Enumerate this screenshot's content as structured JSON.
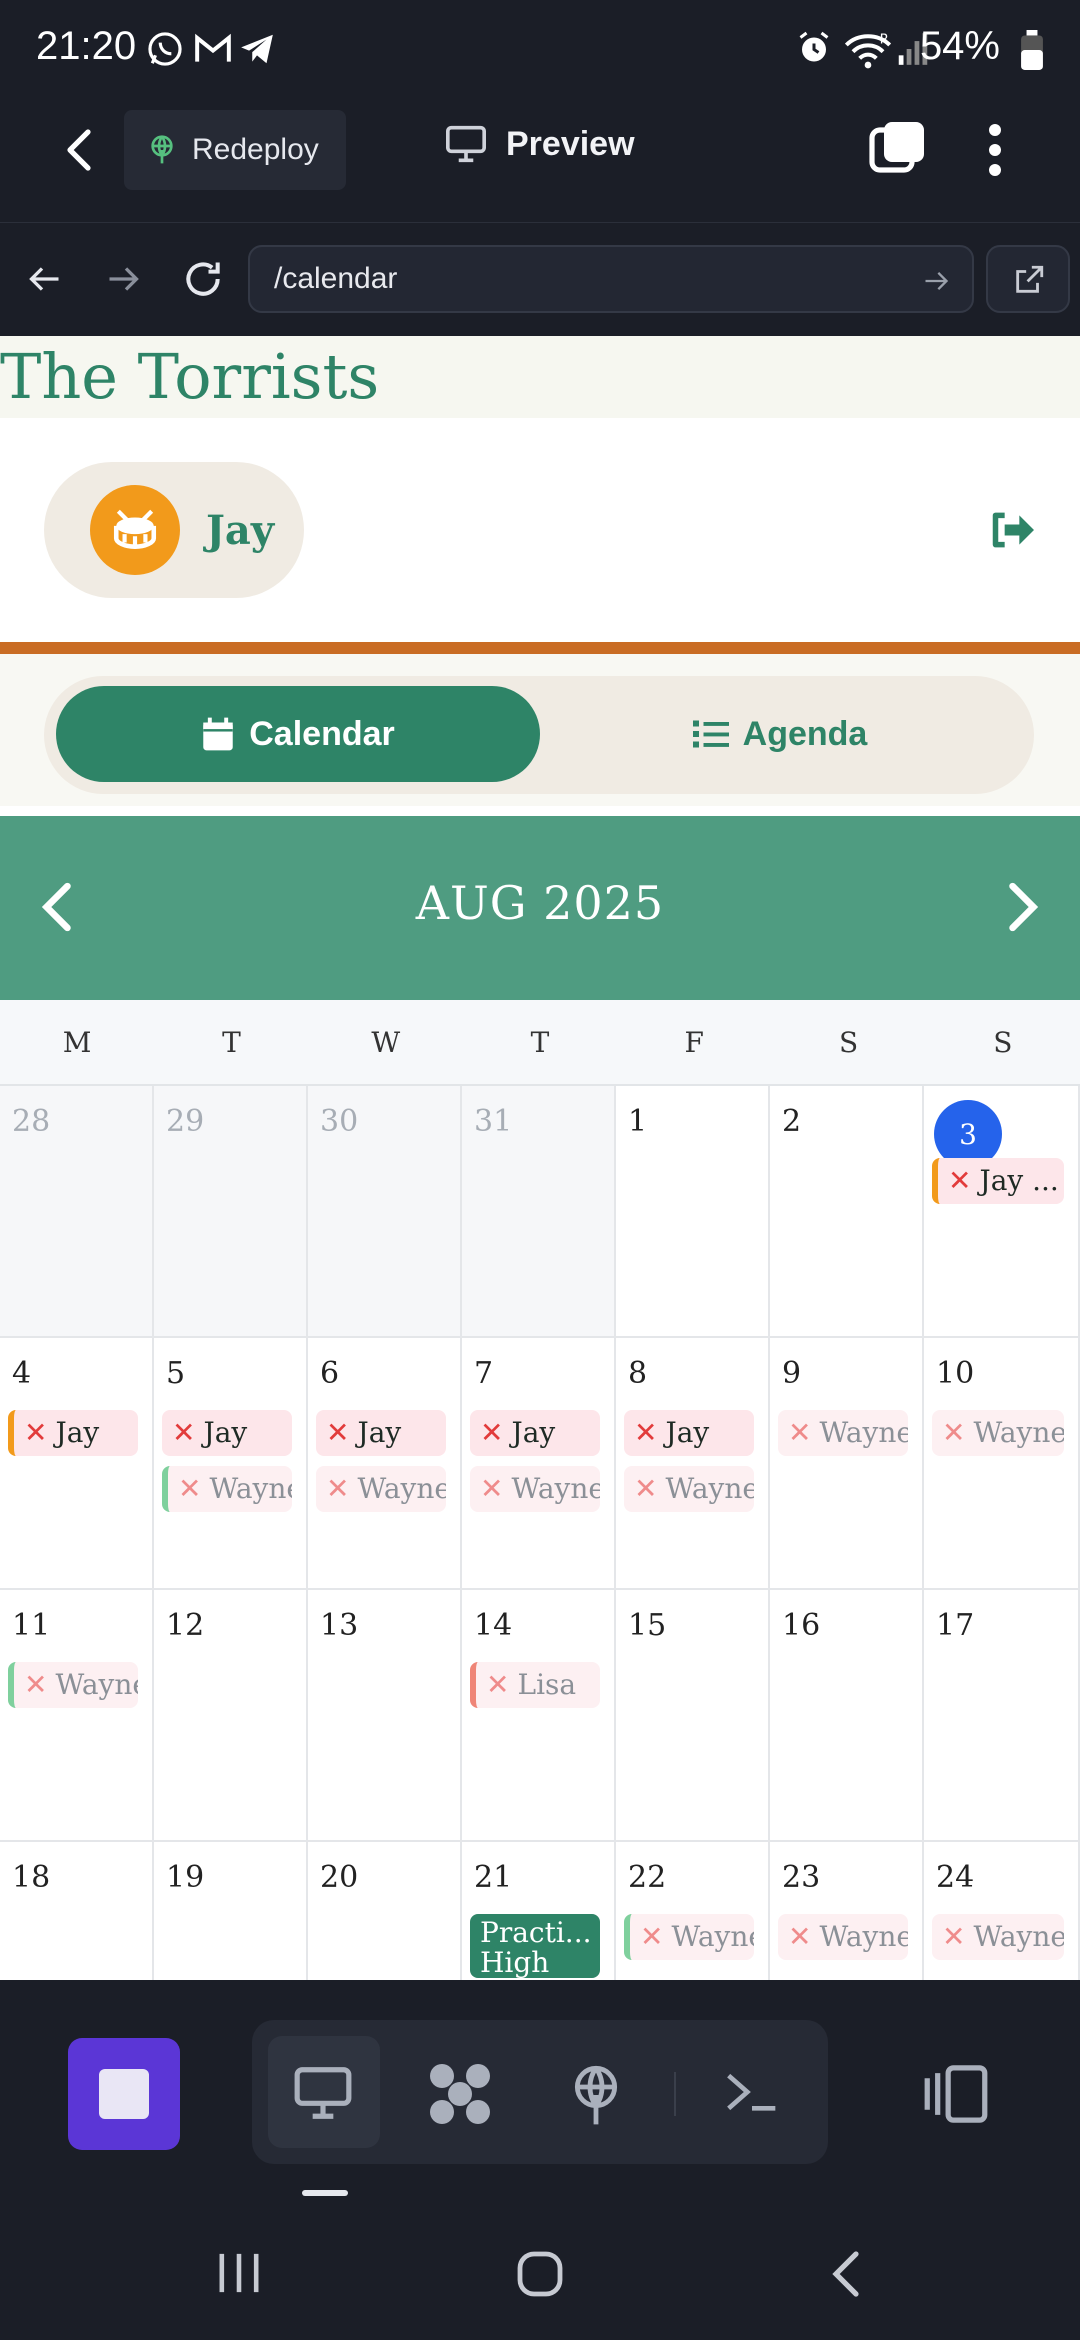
{
  "status": {
    "time": "21:20",
    "battery": "54%"
  },
  "app_toolbar": {
    "redeploy_label": "Redeploy",
    "preview_label": "Preview"
  },
  "url_bar": {
    "value": "/calendar"
  },
  "site": {
    "brand": "The Torrists",
    "user_name": "Jay"
  },
  "tabs": {
    "calendar": "Calendar",
    "agenda": "Agenda"
  },
  "month": {
    "title": "AUG 2025"
  },
  "weekdays": [
    "M",
    "T",
    "W",
    "T",
    "F",
    "S",
    "S"
  ],
  "weeks": [
    {
      "days": [
        {
          "n": "28",
          "other": true,
          "events": []
        },
        {
          "n": "29",
          "other": true,
          "events": []
        },
        {
          "n": "30",
          "other": true,
          "events": []
        },
        {
          "n": "31",
          "other": true,
          "events": []
        },
        {
          "n": "1",
          "events": []
        },
        {
          "n": "2",
          "events": []
        },
        {
          "n": "3",
          "today": true,
          "events": [
            {
              "text": "Jay ...",
              "style": "strong",
              "accent": "or",
              "x": true
            }
          ]
        }
      ]
    },
    {
      "days": [
        {
          "n": "4",
          "events": [
            {
              "text": "Jay",
              "style": "strong",
              "accent": "or",
              "x": true
            }
          ]
        },
        {
          "n": "5",
          "events": [
            {
              "text": "Jay",
              "style": "strong",
              "x": true
            },
            {
              "text": "Wayne",
              "style": "soft",
              "accent": "gr",
              "x": true
            }
          ]
        },
        {
          "n": "6",
          "events": [
            {
              "text": "Jay",
              "style": "strong",
              "x": true
            },
            {
              "text": "Wayne",
              "style": "soft",
              "x": true
            }
          ]
        },
        {
          "n": "7",
          "events": [
            {
              "text": "Jay",
              "style": "strong",
              "x": true
            },
            {
              "text": "Wayne",
              "style": "soft",
              "x": true
            }
          ]
        },
        {
          "n": "8",
          "events": [
            {
              "text": "Jay",
              "style": "strong",
              "x": true
            },
            {
              "text": "Wayne",
              "style": "soft",
              "x": true
            }
          ]
        },
        {
          "n": "9",
          "events": [
            {
              "text": "Wayne",
              "style": "soft",
              "x": true
            }
          ]
        },
        {
          "n": "10",
          "events": [
            {
              "text": "Wayne",
              "style": "soft",
              "x": true
            }
          ]
        }
      ]
    },
    {
      "days": [
        {
          "n": "11",
          "events": [
            {
              "text": "Wayne",
              "style": "soft",
              "accent": "gr",
              "x": true
            }
          ]
        },
        {
          "n": "12",
          "events": []
        },
        {
          "n": "13",
          "events": []
        },
        {
          "n": "14",
          "events": [
            {
              "text": "Lisa",
              "style": "soft",
              "accent": "sal",
              "x": true
            }
          ]
        },
        {
          "n": "15",
          "events": []
        },
        {
          "n": "16",
          "events": []
        },
        {
          "n": "17",
          "events": []
        }
      ]
    },
    {
      "days": [
        {
          "n": "18",
          "events": []
        },
        {
          "n": "19",
          "events": []
        },
        {
          "n": "20",
          "events": []
        },
        {
          "n": "21",
          "events": [
            {
              "text": "Practi... High",
              "style": "green"
            }
          ]
        },
        {
          "n": "22",
          "events": [
            {
              "text": "Wayne",
              "style": "soft",
              "accent": "gr",
              "x": true
            }
          ]
        },
        {
          "n": "23",
          "events": [
            {
              "text": "Wayne",
              "style": "soft",
              "x": true
            }
          ]
        },
        {
          "n": "24",
          "events": [
            {
              "text": "Wayne",
              "style": "soft",
              "x": true
            }
          ]
        }
      ]
    }
  ]
}
